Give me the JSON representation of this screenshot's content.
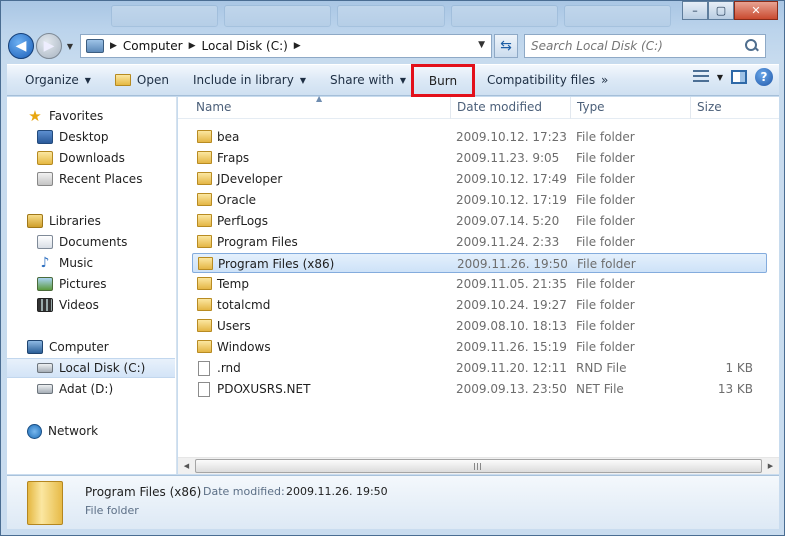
{
  "window": {
    "minimize": "–",
    "maximize": "▢",
    "close": "✕"
  },
  "address": {
    "crumbs": [
      "Computer",
      "Local Disk (C:)"
    ]
  },
  "search": {
    "placeholder": "Search Local Disk (C:)"
  },
  "toolbar": {
    "organize": "Organize",
    "open": "Open",
    "include_in_library": "Include in library",
    "share_with": "Share with",
    "burn": "Burn",
    "compatibility_files": "Compatibility files",
    "more": "»",
    "help": "?"
  },
  "sidebar": {
    "favorites": "Favorites",
    "desktop": "Desktop",
    "downloads": "Downloads",
    "recent_places": "Recent Places",
    "libraries": "Libraries",
    "documents": "Documents",
    "music": "Music",
    "pictures": "Pictures",
    "videos": "Videos",
    "computer": "Computer",
    "local_disk": "Local Disk (C:)",
    "adat": "Adat (D:)",
    "network": "Network"
  },
  "columns": {
    "name": "Name",
    "date_modified": "Date modified",
    "type": "Type",
    "size": "Size"
  },
  "files": [
    {
      "name": "bea",
      "date": "2009.10.12. 17:23",
      "type": "File folder",
      "size": "",
      "kind": "folder"
    },
    {
      "name": "Fraps",
      "date": "2009.11.23. 9:05",
      "type": "File folder",
      "size": "",
      "kind": "folder"
    },
    {
      "name": "JDeveloper",
      "date": "2009.10.12. 17:49",
      "type": "File folder",
      "size": "",
      "kind": "folder"
    },
    {
      "name": "Oracle",
      "date": "2009.10.12. 17:19",
      "type": "File folder",
      "size": "",
      "kind": "folder"
    },
    {
      "name": "PerfLogs",
      "date": "2009.07.14. 5:20",
      "type": "File folder",
      "size": "",
      "kind": "folder"
    },
    {
      "name": "Program Files",
      "date": "2009.11.24. 2:33",
      "type": "File folder",
      "size": "",
      "kind": "folder"
    },
    {
      "name": "Program Files (x86)",
      "date": "2009.11.26. 19:50",
      "type": "File folder",
      "size": "",
      "kind": "folder",
      "selected": true
    },
    {
      "name": "Temp",
      "date": "2009.11.05. 21:35",
      "type": "File folder",
      "size": "",
      "kind": "folder"
    },
    {
      "name": "totalcmd",
      "date": "2009.10.24. 19:27",
      "type": "File folder",
      "size": "",
      "kind": "folder"
    },
    {
      "name": "Users",
      "date": "2009.08.10. 18:13",
      "type": "File folder",
      "size": "",
      "kind": "folder"
    },
    {
      "name": "Windows",
      "date": "2009.11.26. 15:19",
      "type": "File folder",
      "size": "",
      "kind": "folder"
    },
    {
      "name": ".rnd",
      "date": "2009.11.20. 12:11",
      "type": "RND File",
      "size": "1 KB",
      "kind": "file"
    },
    {
      "name": "PDOXUSRS.NET",
      "date": "2009.09.13. 23:50",
      "type": "NET File",
      "size": "13 KB",
      "kind": "file"
    }
  ],
  "details": {
    "name": "Program Files (x86)",
    "date_label": "Date modified:",
    "date": "2009.11.26. 19:50",
    "type": "File folder"
  },
  "colors": {
    "burn_highlight": "#e3101a",
    "selection": "#cde2f8"
  }
}
